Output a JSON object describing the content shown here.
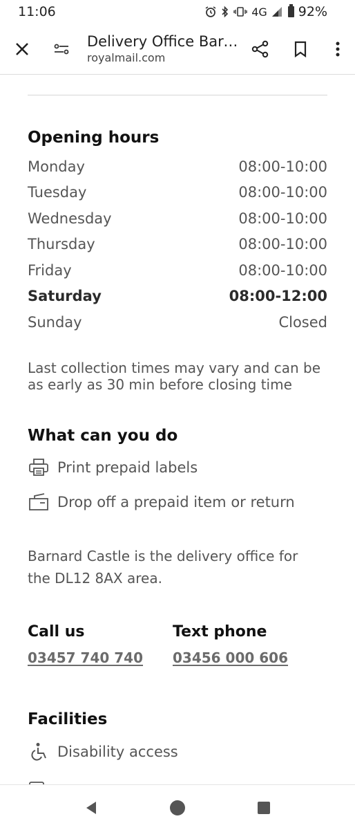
{
  "status_bar": {
    "time": "11:06",
    "network": "4G",
    "battery": "92%"
  },
  "app_bar": {
    "title": "Delivery Office Barnard Castle",
    "url": "royalmail.com"
  },
  "opening_hours": {
    "title": "Opening hours",
    "rows": [
      {
        "day": "Monday",
        "hours": "08:00-10:00"
      },
      {
        "day": "Tuesday",
        "hours": "08:00-10:00"
      },
      {
        "day": "Wednesday",
        "hours": "08:00-10:00"
      },
      {
        "day": "Thursday",
        "hours": "08:00-10:00"
      },
      {
        "day": "Friday",
        "hours": "08:00-10:00"
      },
      {
        "day": "Saturday",
        "hours": "08:00-12:00"
      },
      {
        "day": "Sunday",
        "hours": "Closed"
      }
    ],
    "note": "Last collection times may vary and can be as early as 30 min before closing time"
  },
  "what_can_you_do": {
    "title": "What can you do",
    "items": [
      "Print prepaid labels",
      "Drop off a prepaid item or return"
    ]
  },
  "office_text": "Barnard Castle is the delivery office for the DL12 8AX area.",
  "contact": {
    "call_label": "Call us",
    "call_number": "03457 740 740",
    "text_label": "Text phone",
    "text_number": "03456 000 606"
  },
  "facilities": {
    "title": "Facilities",
    "items": [
      "Disability access"
    ]
  },
  "colors": {
    "text_primary": "#111111",
    "text_secondary": "#555555",
    "link": "#6b6b6b"
  }
}
